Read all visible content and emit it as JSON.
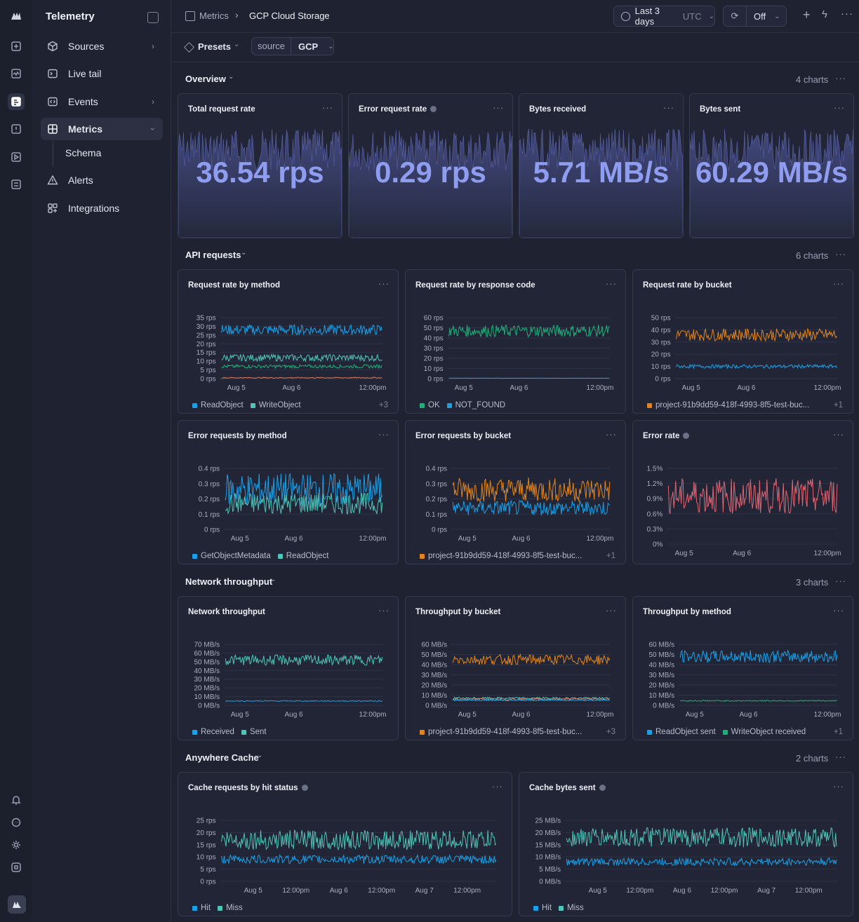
{
  "app": {
    "title": "Telemetry"
  },
  "sidebar": {
    "items": [
      {
        "label": "Sources",
        "icon": "cube-icon",
        "chevron": true
      },
      {
        "label": "Live tail",
        "icon": "terminal-icon",
        "chevron": false
      },
      {
        "label": "Events",
        "icon": "code-icon",
        "chevron": true
      },
      {
        "label": "Metrics",
        "icon": "grid-icon",
        "chevron": true,
        "active": true
      },
      {
        "label": "Alerts",
        "icon": "warning-icon",
        "chevron": false
      },
      {
        "label": "Integrations",
        "icon": "puzzle-icon",
        "chevron": false
      }
    ],
    "sub_item": "Schema"
  },
  "breadcrumb": {
    "parent": "Metrics",
    "current": "GCP Cloud Storage"
  },
  "toolbar": {
    "time_range": "Last 3 days",
    "timezone": "UTC",
    "refresh": "Off"
  },
  "filters": {
    "presets": "Presets",
    "key": "source",
    "value": "GCP"
  },
  "sections": {
    "overview": {
      "title": "Overview",
      "count": "4 charts"
    },
    "api": {
      "title": "API requests",
      "count": "6 charts"
    },
    "network": {
      "title": "Network throughput",
      "count": "3 charts"
    },
    "cache": {
      "title": "Anywhere Cache",
      "count": "2 charts"
    }
  },
  "stats": [
    {
      "title": "Total request rate",
      "value": "36.54 rps",
      "info": false
    },
    {
      "title": "Error request rate",
      "value": "0.29 rps",
      "info": true
    },
    {
      "title": "Bytes received",
      "value": "5.71 MB/s",
      "info": false
    },
    {
      "title": "Bytes sent",
      "value": "60.29 MB/s",
      "info": false
    }
  ],
  "colors": {
    "blue": "#1aa0e8",
    "teal": "#4fc4b8",
    "green": "#1fb07a",
    "orange": "#e3841b",
    "red": "#e26470",
    "salmon": "#e07a5a",
    "accent": "#8f9df0"
  },
  "chart_data": [
    {
      "id": "c1",
      "type": "line",
      "title": "Request rate by method",
      "yticks": [
        "35 rps",
        "30 rps",
        "25 rps",
        "20 rps",
        "15 rps",
        "10 rps",
        "5 rps",
        "0 rps"
      ],
      "ylim": [
        0,
        35
      ],
      "xticks": [
        "Aug 5",
        "Aug 6",
        "12:00pm"
      ],
      "series": [
        {
          "name": "ReadObject",
          "color": "#1aa0e8",
          "mean": 28,
          "amp": 3
        },
        {
          "name": "WriteObject",
          "color": "#4fc4b8",
          "mean": 12,
          "amp": 2
        },
        {
          "color": "#1fb07a",
          "mean": 7,
          "amp": 1
        },
        {
          "color": "#e07a5a",
          "mean": 0.5,
          "amp": 0.3
        }
      ],
      "legend": [
        "ReadObject",
        "WriteObject"
      ],
      "more": "+3",
      "info": false
    },
    {
      "id": "c2",
      "type": "line",
      "title": "Request rate by response code",
      "yticks": [
        "60 rps",
        "50 rps",
        "40 rps",
        "30 rps",
        "20 rps",
        "10 rps",
        "0 rps"
      ],
      "ylim": [
        0,
        60
      ],
      "xticks": [
        "Aug 5",
        "Aug 6",
        "12:00pm"
      ],
      "series": [
        {
          "name": "OK",
          "color": "#1fb07a",
          "mean": 47,
          "amp": 6
        },
        {
          "name": "NOT_FOUND",
          "color": "#1aa0e8",
          "mean": 0.4,
          "amp": 0.1
        }
      ],
      "legend": [
        "OK",
        "NOT_FOUND"
      ],
      "more": "",
      "info": false
    },
    {
      "id": "c3",
      "type": "line",
      "title": "Request rate by bucket",
      "yticks": [
        "50 rps",
        "40 rps",
        "30 rps",
        "20 rps",
        "10 rps",
        "0 rps"
      ],
      "ylim": [
        0,
        50
      ],
      "xticks": [
        "Aug 5",
        "Aug 6",
        "12:00pm"
      ],
      "series": [
        {
          "name": "project-91b9dd59-418f-4993-8f5-test-buc...",
          "color": "#e3841b",
          "mean": 36,
          "amp": 5
        },
        {
          "color": "#1aa0e8",
          "mean": 10,
          "amp": 1.5
        }
      ],
      "legend": [
        "project-91b9dd59-418f-4993-8f5-test-buc..."
      ],
      "more": "+1",
      "info": false
    },
    {
      "id": "c4",
      "type": "line",
      "title": "Error requests by method",
      "yticks": [
        "0.4 rps",
        "0.3 rps",
        "0.2 rps",
        "0.1 rps",
        "0 rps"
      ],
      "ylim": [
        0,
        0.4
      ],
      "xticks": [
        "Aug 5",
        "Aug 6",
        "12:00pm"
      ],
      "series": [
        {
          "name": "GetObjectMetadata",
          "color": "#1aa0e8",
          "mean": 0.26,
          "amp": 0.11
        },
        {
          "name": "ReadObject",
          "color": "#4fc4b8",
          "mean": 0.17,
          "amp": 0.07
        }
      ],
      "legend": [
        "GetObjectMetadata",
        "ReadObject"
      ],
      "more": "",
      "info": false
    },
    {
      "id": "c5",
      "type": "line",
      "title": "Error requests by bucket",
      "yticks": [
        "0.4 rps",
        "0.3 rps",
        "0.2 rps",
        "0.1 rps",
        "0 rps"
      ],
      "ylim": [
        0,
        0.4
      ],
      "xticks": [
        "Aug 5",
        "Aug 6",
        "12:00pm"
      ],
      "series": [
        {
          "name": "project-91b9dd59-418f-4993-8f5-test-buc...",
          "color": "#e3841b",
          "mean": 0.26,
          "amp": 0.08
        },
        {
          "color": "#1aa0e8",
          "mean": 0.14,
          "amp": 0.05
        }
      ],
      "legend": [
        "project-91b9dd59-418f-4993-8f5-test-buc..."
      ],
      "more": "+1",
      "info": false
    },
    {
      "id": "c6",
      "type": "line",
      "title": "Error rate",
      "yticks": [
        "1.5%",
        "1.2%",
        "0.9%",
        "0.6%",
        "0.3%",
        "0%"
      ],
      "ylim": [
        0,
        1.5
      ],
      "xticks": [
        "Aug 5",
        "Aug 6",
        "12:00pm"
      ],
      "series": [
        {
          "color": "#e26470",
          "mean": 0.95,
          "amp": 0.35
        }
      ],
      "legend": [],
      "more": "",
      "info": true
    },
    {
      "id": "c7",
      "type": "line",
      "title": "Network throughput",
      "yticks": [
        "70 MB/s",
        "60 MB/s",
        "50 MB/s",
        "40 MB/s",
        "30 MB/s",
        "20 MB/s",
        "10 MB/s",
        "0 MB/s"
      ],
      "ylim": [
        0,
        70
      ],
      "xticks": [
        "Aug 5",
        "Aug 6",
        "12:00pm"
      ],
      "series": [
        {
          "name": "Received",
          "color": "#1aa0e8",
          "mean": 5,
          "amp": 0.6
        },
        {
          "name": "Sent",
          "color": "#4fc4b8",
          "mean": 52,
          "amp": 6
        }
      ],
      "legend": [
        "Received",
        "Sent"
      ],
      "more": "",
      "info": false
    },
    {
      "id": "c8",
      "type": "line",
      "title": "Throughput by bucket",
      "yticks": [
        "60 MB/s",
        "50 MB/s",
        "40 MB/s",
        "30 MB/s",
        "20 MB/s",
        "10 MB/s",
        "0 MB/s"
      ],
      "ylim": [
        0,
        60
      ],
      "xticks": [
        "Aug 5",
        "Aug 6",
        "12:00pm"
      ],
      "series": [
        {
          "name": "project-91b9dd59-418f-4993-8f5-test-buc...",
          "color": "#e3841b",
          "mean": 45,
          "amp": 5
        },
        {
          "color": "#4fc4b8",
          "mean": 7,
          "amp": 1
        },
        {
          "color": "#e07a5a",
          "mean": 6,
          "amp": 1
        },
        {
          "color": "#1aa0e8",
          "mean": 5,
          "amp": 0.6
        }
      ],
      "legend": [
        "project-91b9dd59-418f-4993-8f5-test-buc..."
      ],
      "more": "+3",
      "info": false
    },
    {
      "id": "c9",
      "type": "line",
      "title": "Throughput by method",
      "yticks": [
        "60 MB/s",
        "50 MB/s",
        "40 MB/s",
        "30 MB/s",
        "20 MB/s",
        "10 MB/s",
        "0 MB/s"
      ],
      "ylim": [
        0,
        60
      ],
      "xticks": [
        "Aug 5",
        "Aug 6",
        "12:00pm"
      ],
      "series": [
        {
          "name": "ReadObject sent",
          "color": "#1aa0e8",
          "mean": 48,
          "amp": 6
        },
        {
          "name": "WriteObject received",
          "color": "#1fb07a",
          "mean": 4.5,
          "amp": 0.6
        }
      ],
      "legend": [
        "ReadObject sent",
        "WriteObject received"
      ],
      "more": "+1",
      "info": false
    },
    {
      "id": "c10",
      "type": "line",
      "title": "Cache requests by hit status",
      "yticks": [
        "25 rps",
        "20 rps",
        "15 rps",
        "10 rps",
        "5 rps",
        "0 rps"
      ],
      "ylim": [
        0,
        25
      ],
      "xticks": [
        "Aug 5",
        "12:00pm",
        "Aug 6",
        "12:00pm",
        "Aug 7",
        "12:00pm"
      ],
      "series": [
        {
          "name": "Hit",
          "color": "#1aa0e8",
          "mean": 9,
          "amp": 1.8
        },
        {
          "name": "Miss",
          "color": "#4fc4b8",
          "mean": 17,
          "amp": 4
        }
      ],
      "legend": [
        "Hit",
        "Miss"
      ],
      "more": "",
      "info": true
    },
    {
      "id": "c11",
      "type": "line",
      "title": "Cache bytes sent",
      "yticks": [
        "25 MB/s",
        "20 MB/s",
        "15 MB/s",
        "10 MB/s",
        "5 MB/s",
        "0 MB/s"
      ],
      "ylim": [
        0,
        25
      ],
      "xticks": [
        "Aug 5",
        "12:00pm",
        "Aug 6",
        "12:00pm",
        "Aug 7",
        "12:00pm"
      ],
      "series": [
        {
          "name": "Hit",
          "color": "#1aa0e8",
          "mean": 8,
          "amp": 1.6
        },
        {
          "name": "Miss",
          "color": "#4fc4b8",
          "mean": 18,
          "amp": 4
        }
      ],
      "legend": [
        "Hit",
        "Miss"
      ],
      "more": "",
      "info": true
    }
  ]
}
